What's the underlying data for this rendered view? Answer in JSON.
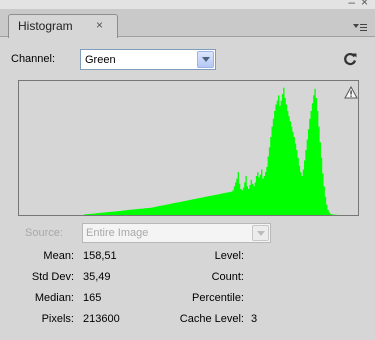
{
  "window": {
    "minimize_glyph": "–",
    "close_glyph": "×"
  },
  "tab": {
    "title": "Histogram",
    "close_glyph": "×"
  },
  "channel": {
    "label": "Channel:",
    "value": "Green"
  },
  "source": {
    "label": "Source:",
    "value": "Entire Image"
  },
  "stats": {
    "mean_label": "Mean:",
    "mean": "158,51",
    "stddev_label": "Std Dev:",
    "stddev": "35,49",
    "median_label": "Median:",
    "median": "165",
    "pixels_label": "Pixels:",
    "pixels": "213600",
    "level_label": "Level:",
    "level": "",
    "count_label": "Count:",
    "count": "",
    "percentile_label": "Percentile:",
    "percentile": "",
    "cache_label": "Cache Level:",
    "cache": "3"
  },
  "histogram": {
    "color": "#00ff00",
    "icons": [
      "refresh-icon",
      "warning-icon",
      "panel-menu-icon",
      "chevron-down-icon"
    ],
    "levels": [
      0,
      0,
      0,
      0,
      0,
      0,
      0,
      0,
      0,
      0,
      0,
      0,
      0,
      0,
      0,
      0,
      0,
      0,
      0,
      0,
      0,
      0,
      0,
      0,
      0,
      0,
      0,
      0,
      0,
      0,
      0,
      0,
      0,
      0,
      0,
      0,
      0,
      0,
      0,
      0,
      0,
      0,
      0,
      0,
      0,
      0,
      0,
      0,
      0,
      0,
      0.005,
      0.006,
      0.007,
      0.008,
      0.009,
      0.009,
      0.01,
      0.011,
      0.012,
      0.013,
      0.014,
      0.015,
      0.016,
      0.017,
      0.018,
      0.019,
      0.02,
      0.021,
      0.022,
      0.023,
      0.024,
      0.025,
      0.026,
      0.027,
      0.028,
      0.029,
      0.03,
      0.031,
      0.032,
      0.034,
      0.035,
      0.036,
      0.037,
      0.038,
      0.039,
      0.04,
      0.041,
      0.042,
      0.043,
      0.044,
      0.045,
      0.046,
      0.047,
      0.048,
      0.049,
      0.05,
      0.051,
      0.052,
      0.053,
      0.054,
      0.055,
      0.056,
      0.058,
      0.06,
      0.062,
      0.064,
      0.066,
      0.068,
      0.07,
      0.072,
      0.074,
      0.076,
      0.078,
      0.08,
      0.082,
      0.084,
      0.086,
      0.088,
      0.09,
      0.092,
      0.094,
      0.096,
      0.098,
      0.1,
      0.102,
      0.104,
      0.106,
      0.108,
      0.11,
      0.112,
      0.114,
      0.116,
      0.118,
      0.12,
      0.122,
      0.124,
      0.126,
      0.128,
      0.13,
      0.132,
      0.134,
      0.136,
      0.138,
      0.14,
      0.142,
      0.144,
      0.146,
      0.148,
      0.15,
      0.152,
      0.154,
      0.156,
      0.158,
      0.16,
      0.162,
      0.164,
      0.166,
      0.168,
      0.17,
      0.172,
      0.174,
      0.176,
      0.178,
      0.18,
      0.19,
      0.22,
      0.25,
      0.28,
      0.33,
      0.24,
      0.2,
      0.19,
      0.21,
      0.25,
      0.3,
      0.22,
      0.2,
      0.23,
      0.27,
      0.24,
      0.22,
      0.25,
      0.3,
      0.33,
      0.29,
      0.31,
      0.35,
      0.28,
      0.3,
      0.33,
      0.37,
      0.45,
      0.52,
      0.6,
      0.68,
      0.74,
      0.8,
      0.85,
      0.88,
      0.92,
      0.84,
      0.88,
      0.93,
      0.98,
      0.9,
      0.85,
      0.8,
      0.76,
      0.72,
      0.68,
      0.64,
      0.6,
      0.55,
      0.5,
      0.44,
      0.38,
      0.33,
      0.3,
      0.35,
      0.42,
      0.5,
      0.58,
      0.66,
      0.74,
      0.8,
      0.86,
      0.92,
      0.97,
      0.9,
      0.8,
      0.68,
      0.56,
      0.44,
      0.32,
      0.22,
      0.14,
      0.08,
      0.04,
      0.02,
      0.01,
      0.006,
      0.004,
      0.003,
      0.002,
      0.001,
      0.001,
      0,
      0,
      0,
      0,
      0,
      0,
      0,
      0,
      0,
      0,
      0,
      0,
      0,
      0,
      0,
      0
    ]
  }
}
